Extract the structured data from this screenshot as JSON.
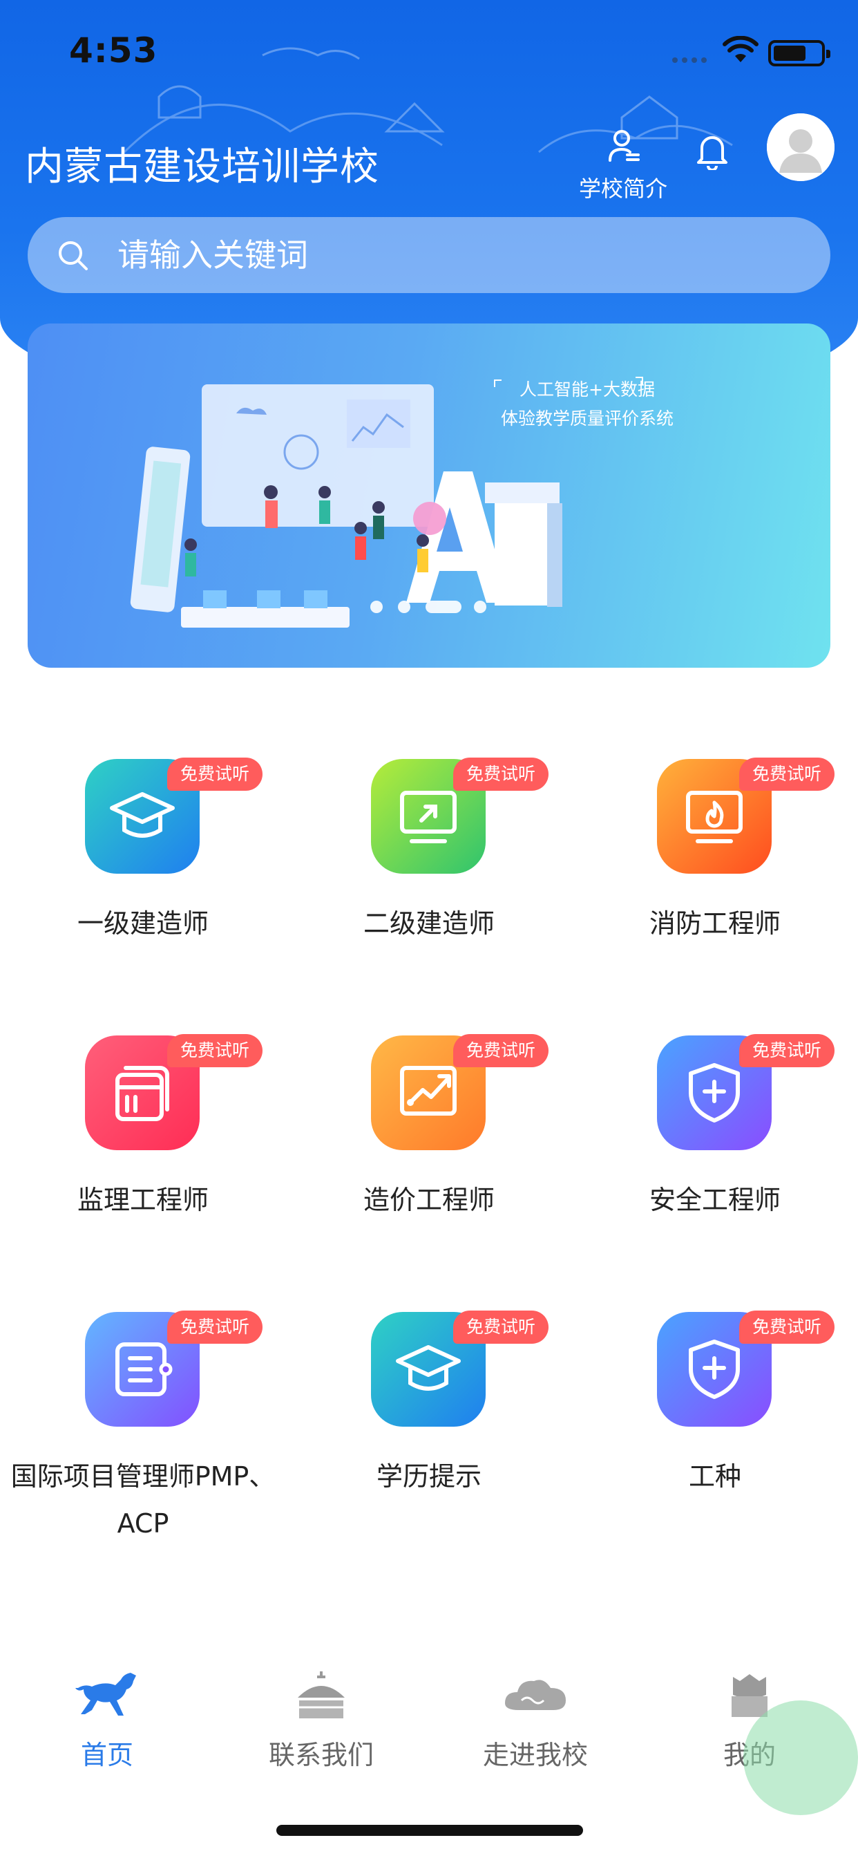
{
  "status": {
    "time": "4:53"
  },
  "header": {
    "school_name": "内蒙古建设培训学校",
    "intro_label": "学校简介",
    "search_placeholder": "请输入关键词"
  },
  "banner": {
    "line1": "人工智能+大数据",
    "line2": "体验教学质量评价系统",
    "slide_count": 4,
    "active_slide": 3
  },
  "courses": [
    {
      "name": "一级建造师",
      "badge": "免费试听",
      "icon": "graduation-cap-icon",
      "gradient": [
        "#2fd1c4",
        "#1f7ff0"
      ]
    },
    {
      "name": "二级建造师",
      "badge": "免费试听",
      "icon": "monitor-arrow-icon",
      "gradient": [
        "#b6ec3a",
        "#2fc46e"
      ]
    },
    {
      "name": "消防工程师",
      "badge": "免费试听",
      "icon": "fire-screen-icon",
      "gradient": [
        "#ffb13b",
        "#ff4d1f"
      ]
    },
    {
      "name": "监理工程师",
      "badge": "免费试听",
      "icon": "documents-icon",
      "gradient": [
        "#ff5f7a",
        "#ff2d55"
      ]
    },
    {
      "name": "造价工程师",
      "badge": "免费试听",
      "icon": "chart-up-icon",
      "gradient": [
        "#ffb847",
        "#ff7a2a"
      ]
    },
    {
      "name": "安全工程师",
      "badge": "免费试听",
      "icon": "shield-plus-icon",
      "gradient": [
        "#4aa3ff",
        "#8a4dff"
      ]
    },
    {
      "name": "国际项目管理师PMP、ACP",
      "badge": "免费试听",
      "icon": "list-icon",
      "gradient": [
        "#62b6ff",
        "#8350ff"
      ]
    },
    {
      "name": "学历提示",
      "badge": "免费试听",
      "icon": "graduation-cap-icon",
      "gradient": [
        "#2fd1c4",
        "#1f7ff0"
      ]
    },
    {
      "name": "工种",
      "badge": "免费试听",
      "icon": "shield-plus-icon",
      "gradient": [
        "#4aa3ff",
        "#8a4dff"
      ]
    }
  ],
  "tabs": [
    {
      "label": "首页",
      "icon": "horse-icon",
      "active": true
    },
    {
      "label": "联系我们",
      "icon": "yurt-icon",
      "active": false
    },
    {
      "label": "走进我校",
      "icon": "cloud-icon",
      "active": false
    },
    {
      "label": "我的",
      "icon": "profile-yurt-icon",
      "active": false
    }
  ],
  "colors": {
    "header_blue": "#1a74ee",
    "badge_red": "#ff5c5c",
    "active_tab": "#2a7be8",
    "inactive_tab": "#666666"
  }
}
